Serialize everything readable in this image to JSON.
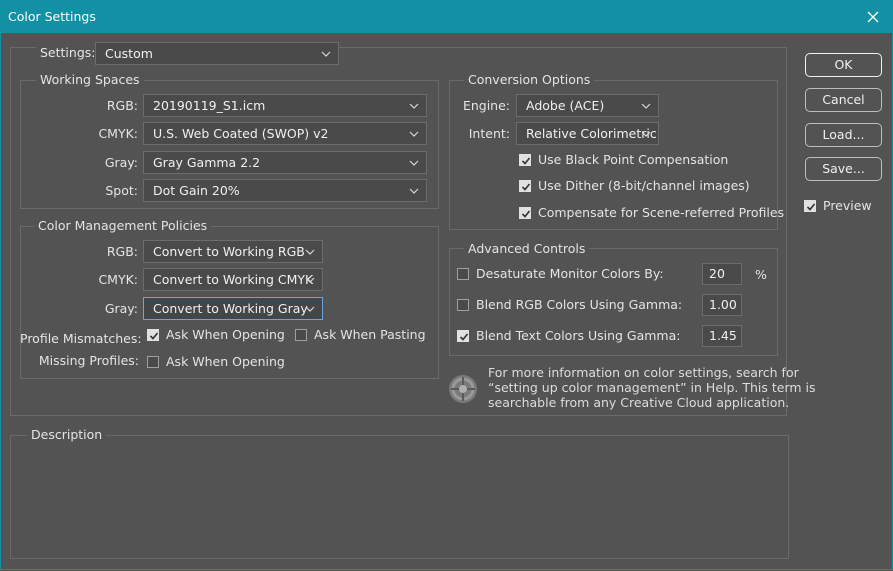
{
  "window": {
    "title": "Color Settings"
  },
  "settings": {
    "label": "Settings:",
    "value": "Custom"
  },
  "working_spaces": {
    "title": "Working Spaces",
    "rgb_label": "RGB:",
    "rgb_value": "20190119_S1.icm",
    "cmyk_label": "CMYK:",
    "cmyk_value": "U.S. Web Coated (SWOP) v2",
    "gray_label": "Gray:",
    "gray_value": "Gray Gamma 2.2",
    "spot_label": "Spot:",
    "spot_value": "Dot Gain 20%"
  },
  "policies": {
    "title": "Color Management Policies",
    "rgb_label": "RGB:",
    "rgb_value": "Convert to Working RGB",
    "cmyk_label": "CMYK:",
    "cmyk_value": "Convert to Working CMYK",
    "gray_label": "Gray:",
    "gray_value": "Convert to Working Gray",
    "mismatch_label": "Profile Mismatches:",
    "mismatch_open": {
      "label": "Ask When Opening",
      "checked": true
    },
    "mismatch_paste": {
      "label": "Ask When Pasting",
      "checked": false
    },
    "missing_label": "Missing Profiles:",
    "missing_open": {
      "label": "Ask When Opening",
      "checked": false
    }
  },
  "conversion": {
    "title": "Conversion Options",
    "engine_label": "Engine:",
    "engine_value": "Adobe (ACE)",
    "intent_label": "Intent:",
    "intent_value": "Relative Colorimetric",
    "black_point": {
      "label": "Use Black Point Compensation",
      "checked": true
    },
    "dither": {
      "label": "Use Dither (8-bit/channel images)",
      "checked": true
    },
    "scene_referred": {
      "label": "Compensate for Scene-referred Profiles",
      "checked": true
    }
  },
  "advanced": {
    "title": "Advanced Controls",
    "desaturate": {
      "label": "Desaturate Monitor Colors By:",
      "checked": false,
      "value": "20",
      "unit": "%"
    },
    "blend_rgb": {
      "label": "Blend RGB Colors Using Gamma:",
      "checked": false,
      "value": "1.00"
    },
    "blend_text": {
      "label": "Blend Text Colors Using Gamma:",
      "checked": true,
      "value": "1.45"
    }
  },
  "info_text": {
    "line1": "For more information on color settings, search for",
    "line2": "“setting up color management” in Help. This term is",
    "line3": "searchable from any Creative Cloud application."
  },
  "description": {
    "title": "Description"
  },
  "buttons": {
    "ok": "OK",
    "cancel": "Cancel",
    "load": "Load...",
    "save": "Save..."
  },
  "preview": {
    "label": "Preview",
    "checked": true
  },
  "colors": {
    "title_bar": "#1290a4",
    "dialog_bg": "#535353",
    "field_bg": "#4a4a4a",
    "focus_border": "#6aa5e0"
  }
}
